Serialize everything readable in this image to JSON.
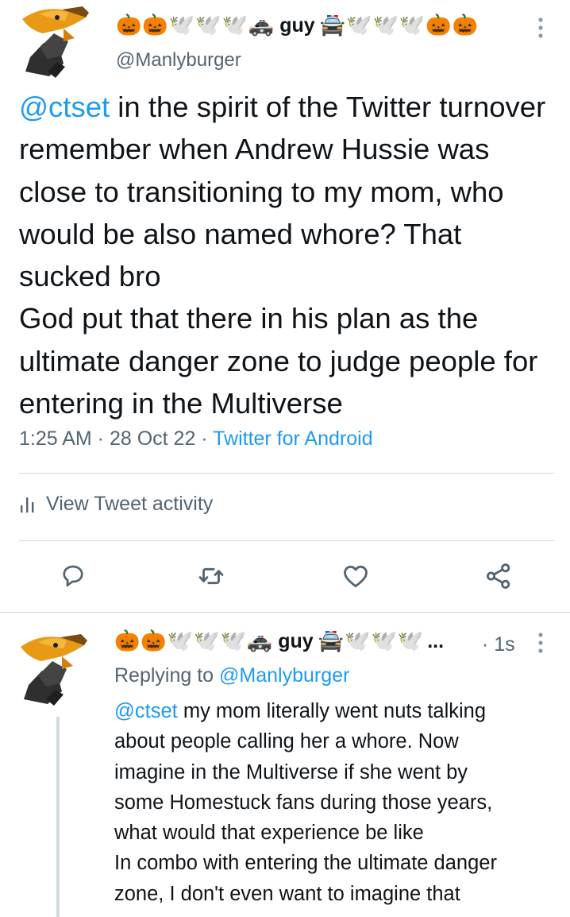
{
  "main_tweet": {
    "display_name": {
      "emoji_before": [
        "🎃",
        "🎃",
        "🕊️",
        "🕊️",
        "🕊️",
        "🚓"
      ],
      "word": "guy",
      "emoji_after": [
        "🚔",
        "🕊️",
        "🕊️",
        "🕊️",
        "🎃",
        "🎃"
      ]
    },
    "handle": "@Manlyburger",
    "text": {
      "mention": "@ctset",
      "body": " in the spirit of the Twitter turnover remember when Andrew Hussie was close to transitioning to my mom, who would be also named whore? That sucked bro\nGod put that there in his plan as the ultimate danger zone to judge people for entering in the Multiverse"
    },
    "time": "1:25 AM",
    "separator": " · ",
    "date": "28 Oct 22",
    "source": "Twitter for Android",
    "activity_label": "View Tweet activity",
    "icons": {
      "more": "more-vertical-icon",
      "activity": "bar-chart-icon",
      "reply": "reply-icon",
      "retweet": "retweet-icon",
      "like": "heart-icon",
      "share": "share-icon"
    }
  },
  "reply_tweet": {
    "display_name": {
      "emoji_before": [
        "🎃",
        "🎃",
        "🕊️",
        "🕊️",
        "🕊️",
        "🚓"
      ],
      "word": "guy",
      "emoji_after": [
        "🚔",
        "🕊️",
        "🕊️",
        "🕊️"
      ],
      "truncation": "..."
    },
    "time": "· 1s",
    "replying_label": "Replying to ",
    "replying_handle": "@Manlyburger",
    "mention": "@ctset",
    "lines": [
      " my mom literally went nuts talking",
      "about people calling her a whore. Now",
      "imagine in the Multiverse if she went by",
      "some Homestuck fans during those years,",
      "what would that experience be like",
      "In combo with entering the ultimate danger",
      "zone, I don't even want to imagine that"
    ]
  },
  "colors": {
    "text": "#0f1419",
    "secondary": "#536471",
    "link": "#1d9bf0",
    "divider": "#cfd9de",
    "icon": "#536471"
  }
}
